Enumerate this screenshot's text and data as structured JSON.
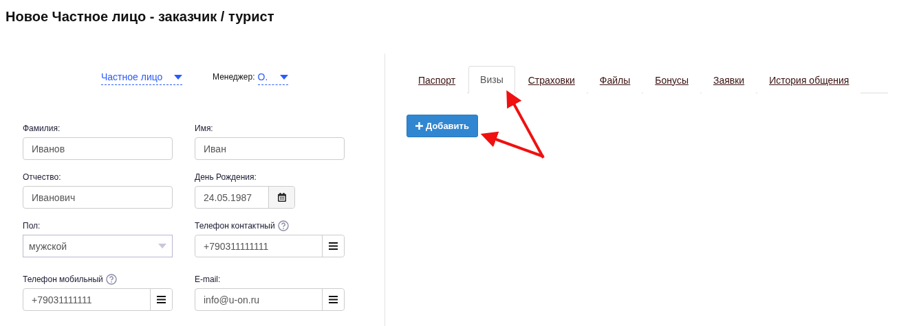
{
  "title": "Новое Частное лицо - заказчик / турист",
  "type_select": {
    "value": "Частное лицо"
  },
  "manager": {
    "label": "Менеджер:",
    "value": "О."
  },
  "fields": [
    {
      "kind": "text",
      "label": "Фамилия:",
      "value": "Иванов",
      "help": false
    },
    {
      "kind": "text",
      "label": "Имя:",
      "value": "Иван",
      "help": false
    },
    {
      "kind": "text",
      "label": "Отчество:",
      "value": "Иванович",
      "help": false
    },
    {
      "kind": "date",
      "label": "День Рождения:",
      "value": "24.05.1987",
      "help": false
    },
    {
      "kind": "select",
      "label": "Пол:",
      "value": "мужской",
      "help": false
    },
    {
      "kind": "menu",
      "label": "Телефон контактный",
      "value": "+790311111111",
      "help": true
    },
    {
      "kind": "menu",
      "label": "Телефон мобильный",
      "value": "+79031111111",
      "help": true
    },
    {
      "kind": "menu",
      "label": "E-mail:",
      "value": "info@u-on.ru",
      "help": false
    }
  ],
  "tabs": [
    {
      "label": "Паспорт",
      "selected": false
    },
    {
      "label": "Визы",
      "selected": true
    },
    {
      "label": "Страховки",
      "selected": false
    },
    {
      "label": "Файлы",
      "selected": false
    },
    {
      "label": "Бонусы",
      "selected": false
    },
    {
      "label": "Заявки",
      "selected": false
    },
    {
      "label": "История общения",
      "selected": false
    }
  ],
  "add_button": {
    "label": "Добавить"
  }
}
